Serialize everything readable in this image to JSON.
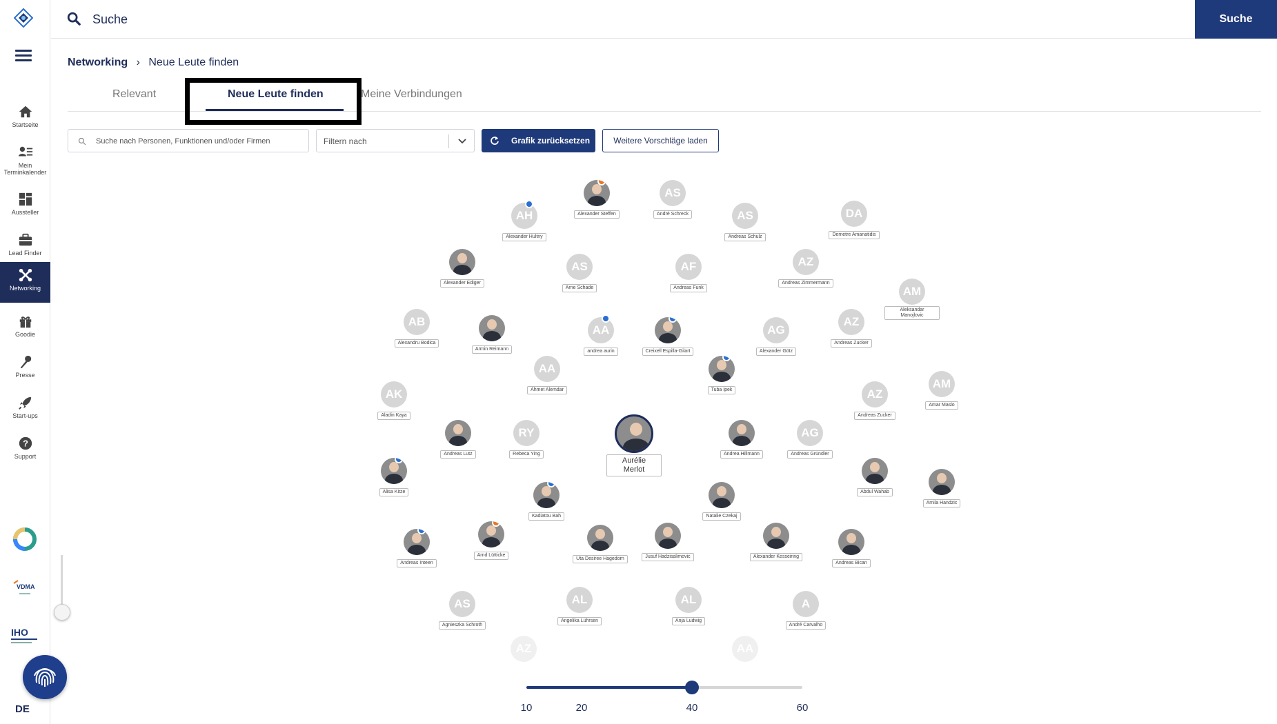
{
  "top_search": {
    "placeholder": "Suche",
    "button_label": "Suche"
  },
  "sidebar": {
    "items": [
      {
        "label": "Startseite",
        "icon": "home-icon"
      },
      {
        "label": "Mein Terminkalender",
        "icon": "calendar-person-icon"
      },
      {
        "label": "Aussteller",
        "icon": "exhibitor-icon"
      },
      {
        "label": "Lead Finder",
        "icon": "briefcase-icon"
      },
      {
        "label": "Networking",
        "icon": "networking-icon",
        "active": true
      },
      {
        "label": "Goodie",
        "icon": "gift-icon"
      },
      {
        "label": "Presse",
        "icon": "microphone-icon"
      },
      {
        "label": "Start-ups",
        "icon": "rocket-icon"
      },
      {
        "label": "Support",
        "icon": "help-icon"
      }
    ],
    "language": "DE"
  },
  "breadcrumb": {
    "root": "Networking",
    "current": "Neue Leute finden"
  },
  "tabs": [
    {
      "label": "Relevant"
    },
    {
      "label": "Neue Leute finden",
      "active": true
    },
    {
      "label": "Meine Verbindungen"
    }
  ],
  "toolbar": {
    "search_placeholder": "Suche nach Personen, Funktionen und/oder Firmen",
    "filter_placeholder": "Filtern nach",
    "reset_label": "Grafik zurücksetzen",
    "more_label": "Weitere Vorschläge laden"
  },
  "graph": {
    "center": {
      "name": "Aurélie Merlot"
    },
    "nodes": [
      {
        "initials": "AH",
        "name": "Alexander Hultny",
        "badge": "blue"
      },
      {
        "initials": "",
        "name": "Alexander Steffen",
        "badge": "orange",
        "photo": true
      },
      {
        "initials": "AS",
        "name": "André Schreck"
      },
      {
        "initials": "AS",
        "name": "Andreas Schulz"
      },
      {
        "initials": "DA",
        "name": "Demetre Amanatidis"
      },
      {
        "initials": "",
        "name": "Alexander Ediger",
        "photo": true
      },
      {
        "initials": "AS",
        "name": "Arne Schade"
      },
      {
        "initials": "AF",
        "name": "Andreas Funk"
      },
      {
        "initials": "AZ",
        "name": "Andreas Zimmermann"
      },
      {
        "initials": "AM",
        "name": "Aleksandar Manojlovic"
      },
      {
        "initials": "AB",
        "name": "Alexandru Bodica"
      },
      {
        "initials": "",
        "name": "Armin Reimann",
        "photo": true
      },
      {
        "initials": "AA",
        "name": "andrea aurin",
        "badge": "blue"
      },
      {
        "initials": "",
        "name": "Creixell Espilla-Gilart",
        "badge": "blue",
        "photo": true
      },
      {
        "initials": "AG",
        "name": "Alexander Götz"
      },
      {
        "initials": "AZ",
        "name": "Andreas Zucker"
      },
      {
        "initials": "AA",
        "name": "Ahmet Alemdar"
      },
      {
        "initials": "",
        "name": "Tuba Ipek",
        "badge": "blue",
        "photo": true
      },
      {
        "initials": "AK",
        "name": "Aladin Kaya"
      },
      {
        "initials": "AM",
        "name": "Amar Maslo"
      },
      {
        "initials": "AZ",
        "name": "Andreas Zucker"
      },
      {
        "initials": "",
        "name": "Andreas Lutz",
        "photo": true
      },
      {
        "initials": "RY",
        "name": "Rebeca Ying"
      },
      {
        "initials": "",
        "name": "Andrea Hillmann",
        "photo": true
      },
      {
        "initials": "AG",
        "name": "Andreas Gründler"
      },
      {
        "initials": "",
        "name": "Alisa Kitze",
        "badge": "blue",
        "photo": true
      },
      {
        "initials": "",
        "name": "Abdul Wahab",
        "photo": true
      },
      {
        "initials": "",
        "name": "Amila Handzic",
        "photo": true
      },
      {
        "initials": "",
        "name": "Kadiatou Bah",
        "badge": "blue",
        "photo": true
      },
      {
        "initials": "",
        "name": "Natalie Czekaj",
        "photo": true
      },
      {
        "initials": "",
        "name": "Arnd Lütticke",
        "badge": "orange",
        "photo": true
      },
      {
        "initials": "",
        "name": "Andreas Inteen",
        "badge": "blue",
        "photo": true
      },
      {
        "initials": "",
        "name": "Uta Desiree Hagedorn",
        "photo": true
      },
      {
        "initials": "",
        "name": "Jusuf Hadzisalimovic",
        "photo": true
      },
      {
        "initials": "",
        "name": "Alexander Kesseiring",
        "photo": true
      },
      {
        "initials": "",
        "name": "Andreas Bican",
        "photo": true
      },
      {
        "initials": "AS",
        "name": "Agnieszka Schroth"
      },
      {
        "initials": "AL",
        "name": "Angelika Lührsen"
      },
      {
        "initials": "AL",
        "name": "Anja Ludwig"
      },
      {
        "initials": "A",
        "name": "André Carvalho"
      },
      {
        "initials": "AZ",
        "name": ""
      },
      {
        "initials": "AA",
        "name": ""
      }
    ]
  },
  "zoom_slider": {
    "ticks": [
      "10",
      "20",
      "40",
      "60"
    ],
    "value": 40,
    "min": 10,
    "max": 60
  },
  "colors": {
    "primary": "#1f3a7a",
    "avatar_placeholder": "#d6d6d6",
    "badge_blue": "#2a6fd1",
    "badge_orange": "#e87722"
  }
}
